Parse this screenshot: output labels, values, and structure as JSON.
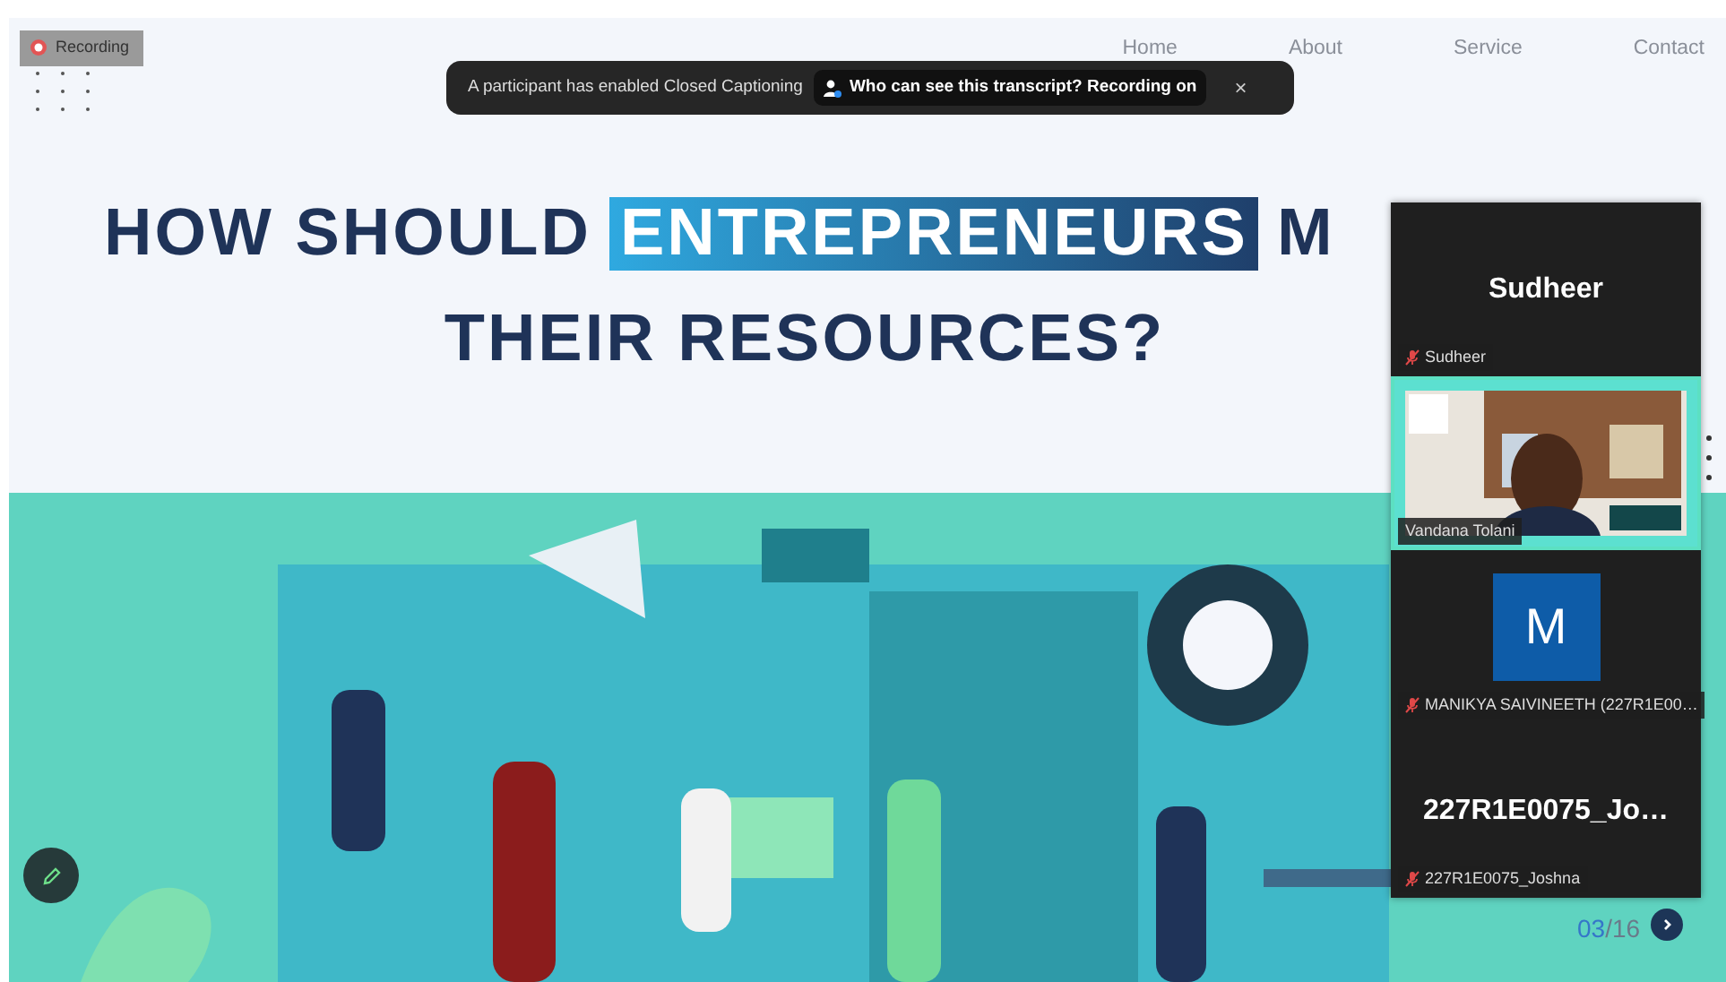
{
  "recording": {
    "label": "Recording"
  },
  "nav": [
    {
      "label": "Home"
    },
    {
      "label": "About"
    },
    {
      "label": "Service"
    },
    {
      "label": "Contact"
    }
  ],
  "toast": {
    "message": "A participant has enabled Closed Captioning",
    "link": "Who can see this transcript? Recording on",
    "close": "×"
  },
  "slide": {
    "before": "HOW SHOULD",
    "highlight": "ENTREPRENEURS",
    "after": "M",
    "line_2": "THEIR RESOURCES?"
  },
  "pager": {
    "current": "03",
    "total": "/16"
  },
  "participants": [
    {
      "kind": "name",
      "title": "Sudheer",
      "name": "Sudheer",
      "muted": true,
      "speaking": false
    },
    {
      "kind": "video",
      "name": "Vandana Tolani",
      "muted": false,
      "speaking": true
    },
    {
      "kind": "avatar",
      "initial": "M",
      "name": "MANIKYA SAIVINEETH  (227R1E00…",
      "muted": true,
      "speaking": false
    },
    {
      "kind": "name",
      "title": "227R1E0075_Jo…",
      "name": "227R1E0075_Joshna",
      "muted": true,
      "speaking": false
    }
  ]
}
